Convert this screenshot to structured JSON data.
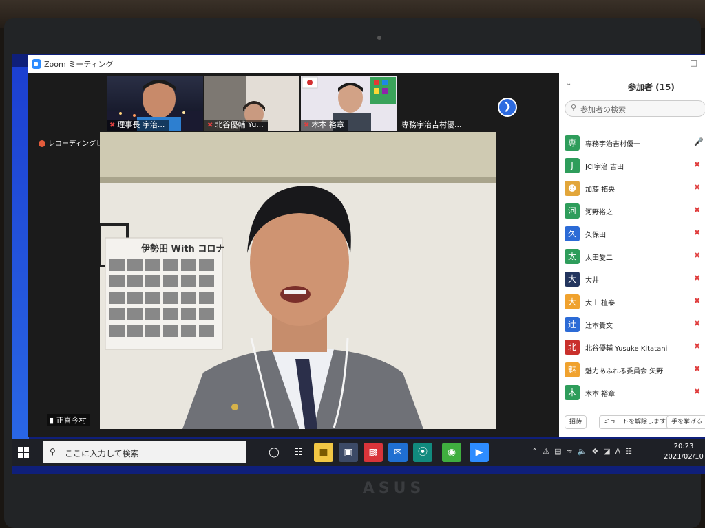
{
  "window": {
    "title": "Zoom ミーティング"
  },
  "recording": {
    "label": "レコーディングしています"
  },
  "thumbnails": [
    {
      "name": "理事長 宇治..."
    },
    {
      "name": "北谷優輔 Yu..."
    },
    {
      "name": "木本 裕章"
    },
    {
      "name": "専務宇治吉村優..."
    }
  ],
  "speaker": {
    "name": "正喜今村"
  },
  "poster": {
    "text": "伊勢田 With コロナ"
  },
  "participants": {
    "title": "参加者 (15)",
    "search_placeholder": "参加者の検索",
    "list": [
      {
        "avatar": "専",
        "color": "#2e9d5b",
        "name": "専務宇治吉村優一",
        "muted": false
      },
      {
        "avatar": "J",
        "color": "#2e9d5b",
        "name": "JCI宇治 吉田",
        "muted": true
      },
      {
        "avatar": "",
        "color": "#e2a63a",
        "name": "加藤 拓央",
        "muted": true
      },
      {
        "avatar": "河",
        "color": "#2e9d5b",
        "name": "河野裕之",
        "muted": true
      },
      {
        "avatar": "久",
        "color": "#2c6bd6",
        "name": "久保田",
        "muted": true
      },
      {
        "avatar": "太",
        "color": "#2e9d5b",
        "name": "太田愛二",
        "muted": true
      },
      {
        "avatar": "大",
        "color": "#23355e",
        "name": "大井",
        "muted": true
      },
      {
        "avatar": "大",
        "color": "#f0a22e",
        "name": "大山 植泰",
        "muted": true
      },
      {
        "avatar": "辻",
        "color": "#2c6bd6",
        "name": "辻本貴文",
        "muted": true
      },
      {
        "avatar": "北",
        "color": "#c9302c",
        "name": "北谷優輔 Yusuke Kitatani",
        "muted": true
      },
      {
        "avatar": "魅",
        "color": "#f0a22e",
        "name": "魅力あふれる委員会 矢野",
        "muted": true
      },
      {
        "avatar": "木",
        "color": "#2e9d5b",
        "name": "木本 裕章",
        "muted": true
      }
    ],
    "footer": {
      "invite": "招待",
      "unmute": "ミュートを解除します",
      "raise_hand": "手を挙げる"
    }
  },
  "taskbar": {
    "search_placeholder": "ここに入力して検索",
    "time": "20:23",
    "date": "2021/02/10",
    "ime": "A"
  }
}
